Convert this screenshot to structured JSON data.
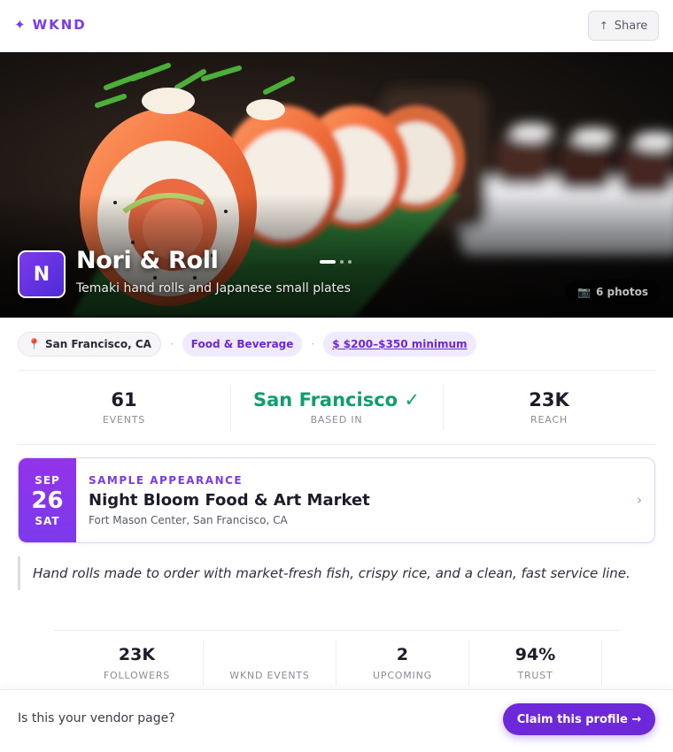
{
  "header": {
    "brand": "WKND",
    "brand_icon": "sparkle-icon",
    "share_label": "Share",
    "share_icon": "share-arrow-icon"
  },
  "hero": {
    "avatar_letter": "N",
    "title": "Nori & Roll",
    "subtitle": "Temaki hand rolls and Japanese small plates",
    "photos_label": "6 photos",
    "photos_icon": "camera-icon",
    "carousel_active_index": 0,
    "carousel_count": 3
  },
  "tags": {
    "location": "San Francisco, CA",
    "location_icon": "pin-icon",
    "category": "Food & Beverage",
    "price": "$ $200–$350 minimum"
  },
  "stats": [
    {
      "value": "61",
      "label": "EVENTS"
    },
    {
      "value": "San Francisco ✓",
      "label": "BASED IN"
    },
    {
      "value": "23K",
      "label": "REACH"
    }
  ],
  "appearance": {
    "month": "SEP",
    "day": "26",
    "weekday": "SAT",
    "kicker": "SAMPLE APPEARANCE",
    "title": "Night Bloom Food & Art Market",
    "place": "Fort Mason Center, San Francisco, CA",
    "chevron_icon": "chevron-right-icon"
  },
  "quote": "Hand rolls made to order with market-fresh fish, crispy rice, and a clean, fast service line.",
  "stats2": [
    {
      "value": "23K",
      "label": "FOLLOWERS"
    },
    {
      "value": "",
      "label": "WKND EVENTS"
    },
    {
      "value": "2",
      "label": "UPCOMING"
    },
    {
      "value": "94%",
      "label": "TRUST"
    }
  ],
  "bottom": {
    "prompt": "Is this your vendor page?",
    "cta": "Claim this profile →"
  },
  "colors": {
    "accent": "#7c3aed",
    "verified": "#0f9f6e"
  }
}
